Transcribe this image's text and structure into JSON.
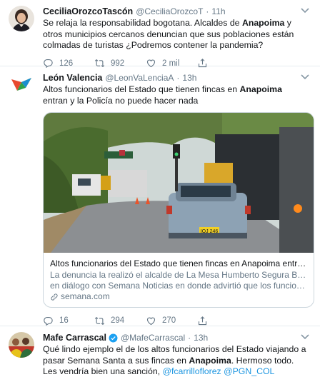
{
  "tweets": [
    {
      "name": "CeciliaOrozcoTascón",
      "handle": "@CeciliaOrozcoT",
      "separator": "·",
      "time": "11h",
      "text_parts": [
        {
          "t": "Se relaja la responsabilidad bogotana. Alcaldes de ",
          "s": "normal"
        },
        {
          "t": "Anapoima",
          "s": "bold"
        },
        {
          "t": " y otros municipios cercanos denuncian que sus poblaciones están colmadas de turistas ¿Podremos contener la pandemia?",
          "s": "normal"
        }
      ],
      "replies": "126",
      "retweets": "992",
      "likes": "2 mil",
      "share": ""
    },
    {
      "name": "León Valencia",
      "handle": "@LeonVaLenciaA",
      "separator": "·",
      "time": "13h",
      "text_parts": [
        {
          "t": "Altos funcionarios del Estado que tienen fincas en ",
          "s": "normal"
        },
        {
          "t": "Anapoima",
          "s": "bold"
        },
        {
          "t": " entran y la Policía no puede hacer nada",
          "s": "normal"
        }
      ],
      "card": {
        "title": "Altos funcionarios del Estado que tienen fincas en Anapoima entran y la...",
        "desc_line1": "La denuncia la realizó el alcalde de La Mesa Humberto Segura Barragán",
        "desc_line2": "en diálogo con Semana Noticias en donde advirtió que los funcionarios ...",
        "domain": "semana.com",
        "plate": "IOJ 246"
      },
      "replies": "16",
      "retweets": "294",
      "likes": "270",
      "share": ""
    },
    {
      "name": "Mafe Carrascal",
      "handle": "@MafeCarrascal",
      "separator": "·",
      "time": "13h",
      "verified": true,
      "text_parts": [
        {
          "t": "Qué lindo ejemplo el de los altos funcionarios del Estado viajando a pasar Semana Santa a sus fincas en ",
          "s": "normal"
        },
        {
          "t": "Anapoima",
          "s": "bold"
        },
        {
          "t": ". Hermoso todo. Les vendría bien una sanción, ",
          "s": "normal"
        },
        {
          "t": "@fcarrilloflorez",
          "s": "link"
        },
        {
          "t": " ",
          "s": "normal"
        },
        {
          "t": "@PGN_COL",
          "s": "link"
        }
      ]
    }
  ],
  "icons": {
    "reply": "reply-icon",
    "retweet": "retweet-icon",
    "like": "heart-icon",
    "share": "share-icon",
    "more": "chevron-down-icon",
    "verified": "verified-badge-icon",
    "link": "link-icon"
  },
  "colors": {
    "text": "#14171a",
    "secondary": "#657786",
    "link": "#1b95e0",
    "border": "#e6ecf0"
  }
}
